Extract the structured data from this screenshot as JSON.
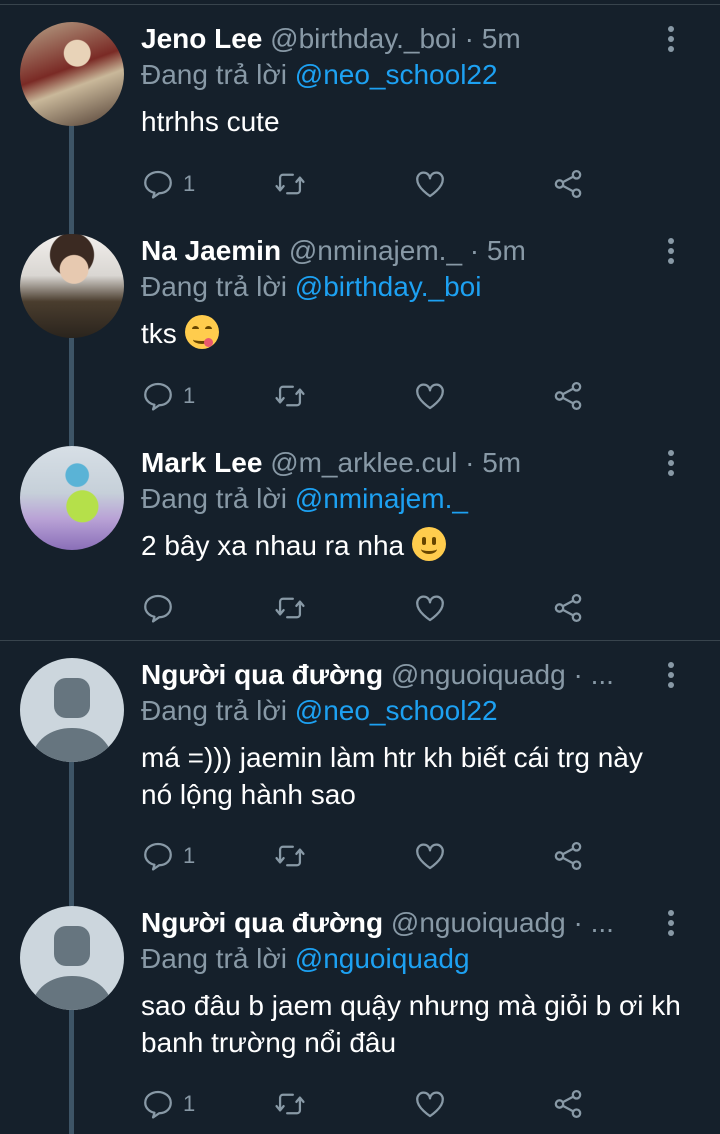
{
  "labels": {
    "replying_to": "Đang trả lời"
  },
  "tweets": [
    {
      "name": "Jeno Lee",
      "handle": "@birthday._boi",
      "time": "· 5m",
      "mention": "@neo_school22",
      "text": "htrhhs cute",
      "reply_count": "1"
    },
    {
      "name": "Na Jaemin",
      "handle": "@nminajem._",
      "time": "· 5m",
      "mention": "@birthday._boi",
      "text": "tks",
      "reply_count": "1"
    },
    {
      "name": "Mark Lee",
      "handle": "@m_arklee.cul",
      "time": "· 5m",
      "mention": "@nminajem._",
      "text": "2 bây xa nhau ra nha",
      "reply_count": ""
    },
    {
      "name": "Người qua đường",
      "handle": "@nguoiquadg",
      "time": "· ...",
      "mention": "@neo_school22",
      "text": "má =))) jaemin làm htr kh biết cái trg này nó lộng hành sao",
      "reply_count": "1"
    },
    {
      "name": "Người qua đường",
      "handle": "@nguoiquadg",
      "time": "· ...",
      "mention": "@nguoiquadg",
      "text": "sao đâu b jaem quậy nhưng mà giỏi b ơi kh banh trường nổi đâu",
      "reply_count": "1"
    }
  ],
  "icons": {
    "reply": "reply-icon",
    "retweet": "retweet-icon",
    "like": "like-icon",
    "share": "share-icon",
    "more": "more-vertical-icon"
  },
  "colors": {
    "background": "#15202b",
    "mention": "#1da1f2",
    "muted": "#8899a6",
    "divider": "#38444d"
  }
}
